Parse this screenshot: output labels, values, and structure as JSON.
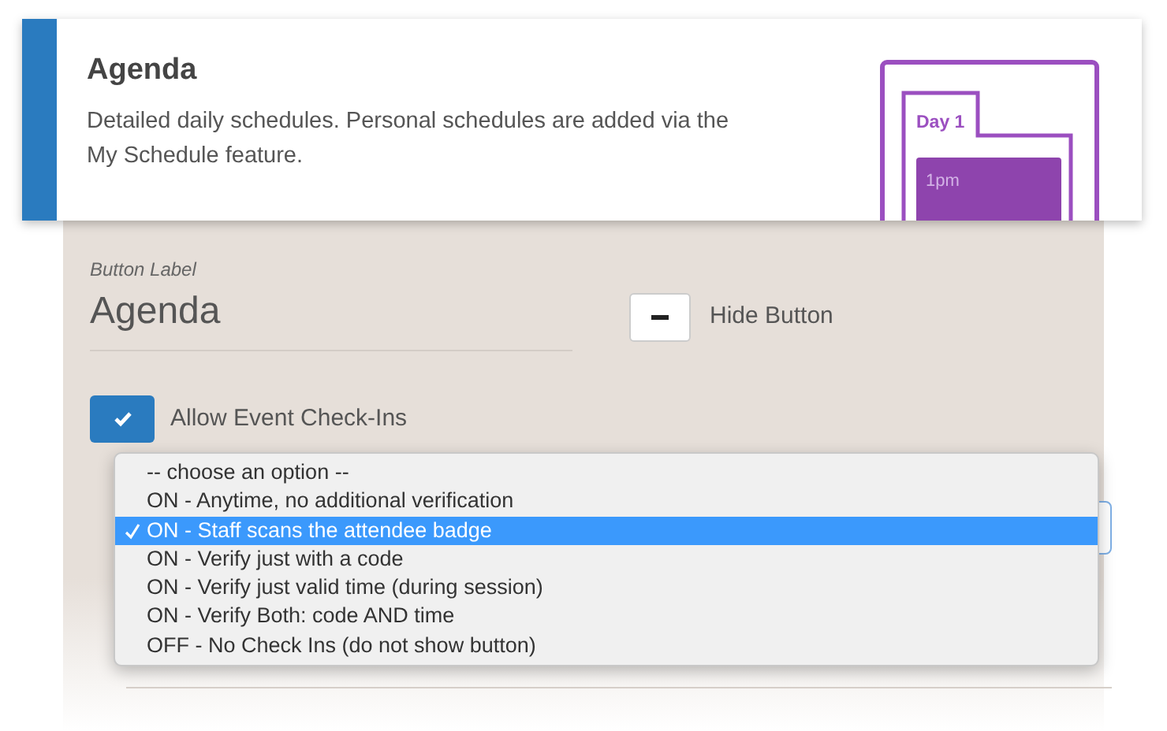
{
  "card": {
    "title": "Agenda",
    "description": "Detailed daily schedules. Personal schedules are added via the My Schedule feature.",
    "illustration": {
      "tab_label": "Day 1",
      "event_label": "1pm"
    }
  },
  "form": {
    "field_label": "Button Label",
    "field_value": "Agenda",
    "hide_button_label": "Hide Button",
    "checkin": {
      "label": "Allow Event Check-Ins",
      "checked": true
    },
    "dropdown": {
      "expanded": true,
      "options": [
        {
          "label": "-- choose an option --",
          "selected": false
        },
        {
          "label": "ON - Anytime, no additional verification",
          "selected": false
        },
        {
          "label": "ON - Staff scans the attendee badge",
          "selected": true
        },
        {
          "label": "ON - Verify just with a code",
          "selected": false
        },
        {
          "label": "ON - Verify just valid time (during session)",
          "selected": false
        },
        {
          "label": "ON - Verify Both: code AND time",
          "selected": false
        },
        {
          "label": "OFF - No Check Ins (do not show button)",
          "selected": false
        }
      ]
    }
  }
}
